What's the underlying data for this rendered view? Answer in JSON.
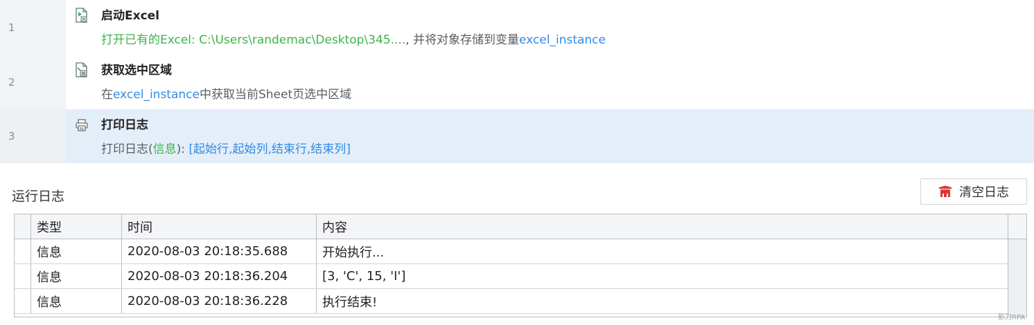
{
  "flow": {
    "steps": [
      {
        "line": "1",
        "icon": "excel-launch-icon",
        "title": "启动Excel",
        "desc_prefix": "打开已有的Excel: C:\\Users\\randemac\\Desktop\\345....",
        "desc_mid": ", 并将对象存储到变量",
        "desc_var": "excel_instance"
      },
      {
        "line": "2",
        "icon": "excel-selection-icon",
        "title": "获取选中区域",
        "desc_prefix": "在",
        "desc_var": "excel_instance",
        "desc_suffix": "中获取当前Sheet页选中区域"
      },
      {
        "line": "3",
        "icon": "printer-icon",
        "title": "打印日志",
        "desc_prefix": "打印日志(",
        "desc_level": "信息",
        "desc_mid": "): ",
        "desc_var": "[起始行,起始列,结束行,结束列]"
      }
    ]
  },
  "log": {
    "title": "运行日志",
    "clear_label": "清空日志",
    "clear_icon": "broom-icon",
    "columns": [
      "类型",
      "时间",
      "内容"
    ],
    "rows": [
      {
        "type": "信息",
        "time": "2020-08-03 20:18:35.688",
        "content": "开始执行..."
      },
      {
        "type": "信息",
        "time": "2020-08-03 20:18:36.204",
        "content": "[3, 'C', 15, 'I']"
      },
      {
        "type": "信息",
        "time": "2020-08-03 20:18:36.228",
        "content": "执行结束!"
      }
    ]
  },
  "watermark": "影刀RPA",
  "colors": {
    "green": "#3db34a",
    "blue": "#2f8be6",
    "selected_bg": "#e4eef9",
    "clear_icon_red": "#d9363e"
  }
}
